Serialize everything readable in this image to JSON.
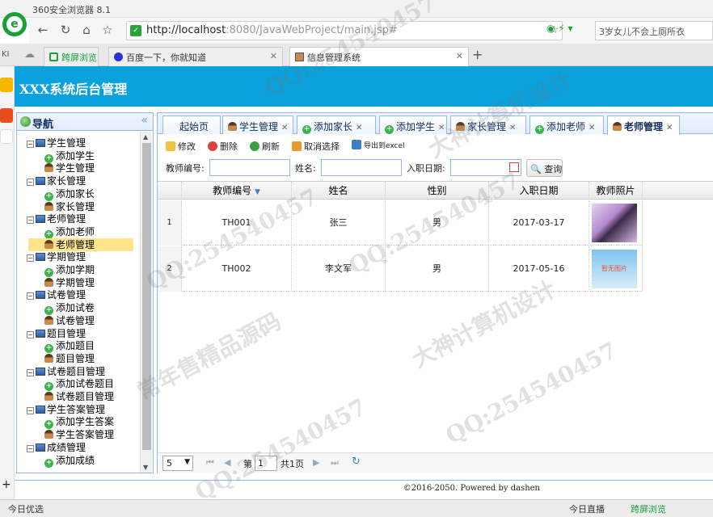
{
  "browser": {
    "title": "360安全浏览器 8.1",
    "url_host": "http://localhost",
    "url_rest": ":8080/JavaWebProject/main.jsp#",
    "search_text": "3岁女儿不会上厕所衣",
    "tabs": [
      {
        "label": "跨屏浏览"
      },
      {
        "label": "百度一下，你就知道"
      },
      {
        "label": "信息管理系统"
      }
    ],
    "status_left": "今日优选",
    "status_live": "今日直播",
    "status_cross": "跨屏浏览"
  },
  "app": {
    "title": "XXX系统后台管理",
    "nav_title": "导航",
    "footer": "©2016-2050. Powered by dashen"
  },
  "tree": [
    {
      "label": "学生管理",
      "level": 0
    },
    {
      "label": "添加学生",
      "level": 1,
      "icon": "add"
    },
    {
      "label": "学生管理",
      "level": 1,
      "icon": "user"
    },
    {
      "label": "家长管理",
      "level": 0
    },
    {
      "label": "添加家长",
      "level": 1,
      "icon": "add"
    },
    {
      "label": "家长管理",
      "level": 1,
      "icon": "user"
    },
    {
      "label": "老师管理",
      "level": 0
    },
    {
      "label": "添加老师",
      "level": 1,
      "icon": "add"
    },
    {
      "label": "老师管理",
      "level": 1,
      "icon": "user",
      "selected": true
    },
    {
      "label": "学期管理",
      "level": 0
    },
    {
      "label": "添加学期",
      "level": 1,
      "icon": "add"
    },
    {
      "label": "学期管理",
      "level": 1,
      "icon": "user"
    },
    {
      "label": "试卷管理",
      "level": 0
    },
    {
      "label": "添加试卷",
      "level": 1,
      "icon": "add"
    },
    {
      "label": "试卷管理",
      "level": 1,
      "icon": "user"
    },
    {
      "label": "题目管理",
      "level": 0
    },
    {
      "label": "添加题目",
      "level": 1,
      "icon": "add"
    },
    {
      "label": "题目管理",
      "level": 1,
      "icon": "user"
    },
    {
      "label": "试卷题目管理",
      "level": 0
    },
    {
      "label": "添加试卷题目",
      "level": 1,
      "icon": "add"
    },
    {
      "label": "试卷题目管理",
      "level": 1,
      "icon": "user"
    },
    {
      "label": "学生答案管理",
      "level": 0
    },
    {
      "label": "添加学生答案",
      "level": 1,
      "icon": "add"
    },
    {
      "label": "学生答案管理",
      "level": 1,
      "icon": "user"
    },
    {
      "label": "成绩管理",
      "level": 0
    },
    {
      "label": "添加成绩",
      "level": 1,
      "icon": "add"
    }
  ],
  "main_tabs": [
    "起始页",
    "学生管理",
    "添加家长",
    "添加学生",
    "家长管理",
    "添加老师",
    "老师管理"
  ],
  "toolbar": {
    "edit": "修改",
    "delete": "删除",
    "refresh": "刷新",
    "cancel_select": "取消选择",
    "export": "导出到excel"
  },
  "query": {
    "teacher_no_label": "教师编号:",
    "name_label": "姓名:",
    "date_label": "入职日期:",
    "search_button": "查询"
  },
  "grid": {
    "columns": [
      "教师编号",
      "姓名",
      "性别",
      "入职日期",
      "教师照片"
    ],
    "rows": [
      {
        "n": "1",
        "no": "TH001",
        "name": "张三",
        "sex": "男",
        "date": "2017-03-17",
        "photo": "portrait"
      },
      {
        "n": "2",
        "no": "TH002",
        "name": "李文军",
        "sex": "男",
        "date": "2017-05-16",
        "photo": "暂无图片"
      }
    ]
  },
  "pager": {
    "page_size": "5",
    "page_prefix": "第",
    "page_value": "1",
    "page_suffix": "共1页"
  },
  "watermarks": [
    "QQ:254540457",
    "大神计算机设计",
    "常年售精品源码"
  ],
  "colors": {
    "header": "#0aa1dc",
    "panel_border": "#95b8e7",
    "selected": "#ffe48d"
  }
}
